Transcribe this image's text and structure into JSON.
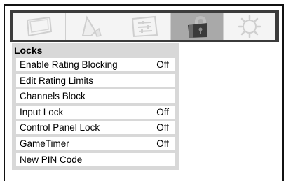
{
  "tabs": [
    {
      "icon": "picture-icon"
    },
    {
      "icon": "sound-icon"
    },
    {
      "icon": "setup-icon"
    },
    {
      "icon": "lock-icon",
      "active": true
    },
    {
      "icon": "preferences-sun-icon"
    }
  ],
  "menu": {
    "title": "Locks",
    "items": [
      {
        "label": "Enable Rating Blocking",
        "value": "Off"
      },
      {
        "label": "Edit Rating Limits",
        "value": ""
      },
      {
        "label": "Channels Block",
        "value": ""
      },
      {
        "label": "Input Lock",
        "value": "Off"
      },
      {
        "label": "Control Panel Lock",
        "value": "Off"
      },
      {
        "label": "GameTimer",
        "value": "Off"
      },
      {
        "label": "New PIN Code",
        "value": ""
      }
    ]
  }
}
